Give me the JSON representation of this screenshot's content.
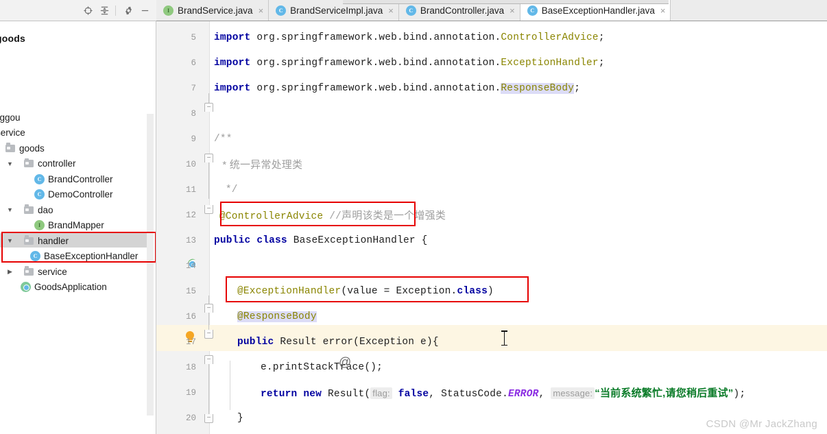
{
  "project_panel": {
    "title": "goods",
    "toolbar": [
      {
        "name": "locate-icon",
        "glyph": "locate"
      },
      {
        "name": "collapse-all-icon",
        "glyph": "collapse"
      },
      {
        "name": "settings-gear-icon",
        "glyph": "gear"
      },
      {
        "name": "minimize-icon",
        "glyph": "minus"
      }
    ],
    "tree": [
      {
        "label": "nggou",
        "indent": 0,
        "arrow": "",
        "icon": "none",
        "selected": false
      },
      {
        "label": "service",
        "indent": 0,
        "arrow": "",
        "icon": "none",
        "selected": false
      },
      {
        "label": "goods",
        "indent": 1,
        "arrow": "",
        "icon": "folder",
        "selected": false
      },
      {
        "label": "controller",
        "indent": 2,
        "arrow": "v",
        "icon": "folder",
        "selected": false
      },
      {
        "label": "BrandController",
        "indent": 4,
        "arrow": "",
        "icon": "class",
        "selected": false
      },
      {
        "label": "DemoController",
        "indent": 4,
        "arrow": "",
        "icon": "class",
        "selected": false
      },
      {
        "label": "dao",
        "indent": 2,
        "arrow": "v",
        "icon": "folder",
        "selected": false
      },
      {
        "label": "BrandMapper",
        "indent": 4,
        "arrow": "",
        "icon": "interface",
        "selected": false
      },
      {
        "label": "handler",
        "indent": 2,
        "arrow": "v",
        "icon": "folder",
        "selected": true
      },
      {
        "label": "BaseExceptionHandler",
        "indent": 4,
        "arrow": "",
        "icon": "class",
        "selected": false
      },
      {
        "label": "service",
        "indent": 2,
        "arrow": ">",
        "icon": "folder",
        "selected": false
      },
      {
        "label": "GoodsApplication",
        "indent": 3,
        "arrow": "",
        "icon": "spring",
        "selected": false
      }
    ]
  },
  "tabs": [
    {
      "label": "BrandService.java",
      "icon": "interface",
      "active": false,
      "close": "×"
    },
    {
      "label": "BrandServiceImpl.java",
      "icon": "class",
      "active": false,
      "close": "×"
    },
    {
      "label": "BrandController.java",
      "icon": "class",
      "active": false,
      "close": "×"
    },
    {
      "label": "BaseExceptionHandler.java",
      "icon": "class",
      "active": true,
      "close": "×"
    }
  ],
  "editor": {
    "line_numbers": [
      "5",
      "6",
      "7",
      "8",
      "9",
      "10",
      "11",
      "12",
      "13",
      "14",
      "15",
      "16",
      "17",
      "18",
      "19",
      "20"
    ],
    "lines": {
      "l5_kw": "import",
      "l5_pkg": " org.springframework.web.bind.annotation.",
      "l5_cls": "ControllerAdvice",
      "l5_end": ";",
      "l6_kw": "import",
      "l6_pkg": " org.springframework.web.bind.annotation.",
      "l6_cls": "ExceptionHandler",
      "l6_end": ";",
      "l7_kw": "import",
      "l7_pkg": " org.springframework.web.bind.annotation.",
      "l7_cls": "ResponseBody",
      "l7_end": ";",
      "l9": "/**",
      "l10": " * 统一异常处理类",
      "l11": " */",
      "l12_anno": "@ControllerAdvice",
      "l12_cmt": " //",
      "l12_cmt_cn": "声明该类是一个增强类",
      "l13_kw1": "public",
      "l13_kw2": "class",
      "l13_name": " BaseExceptionHandler {",
      "l15_anno": "@ExceptionHandler",
      "l15_args": "(value = Exception.",
      "l15_kw": "class",
      "l15_end": ")",
      "l16_anno": "@ResponseBody",
      "l17_kw": "public",
      "l17_rest": " Result error(Exception e){",
      "l18": "e.printStackTrace();",
      "l19_kw1": "return",
      "l19_kw2": "new",
      "l19_call": " Result(",
      "l19_hint1": "flag:",
      "l19_false": "false",
      "l19_mid": ", StatusCode.",
      "l19_error": "ERROR",
      "l19_comma": ",",
      "l19_hint2": "message:",
      "l19_str": "“当前系统繁忙,请您稍后重试”",
      "l19_end": ");",
      "l20": "}"
    }
  },
  "watermark": "CSDN @Mr JackZhang",
  "colors": {
    "keyword": "#0000a0",
    "annotation": "#8a8500",
    "comment": "#9e9e9e",
    "string": "#0a7b28",
    "static_field": "#8a2be2",
    "highlight_box": "#e60000",
    "current_line": "#fdf6e3",
    "selection": "#dcdcf7"
  }
}
